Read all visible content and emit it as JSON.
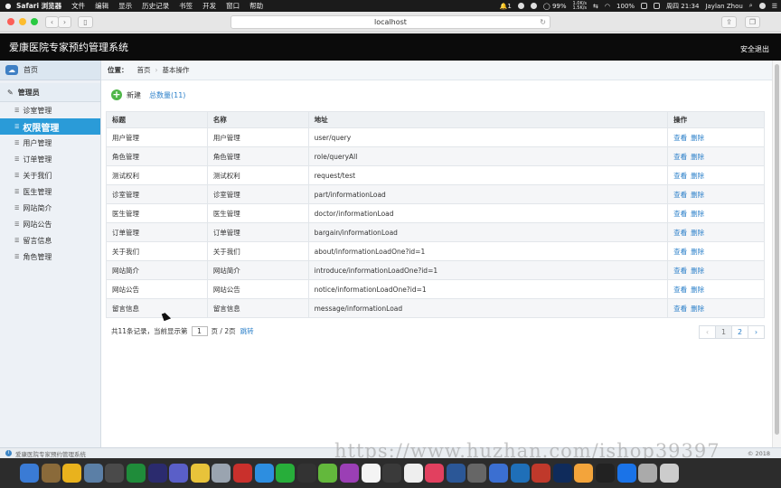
{
  "menubar": {
    "app_name": "Safari 浏览器",
    "items": [
      "文件",
      "编辑",
      "显示",
      "历史记录",
      "书签",
      "开发",
      "窗口",
      "帮助"
    ],
    "notification_count": "1",
    "net_up": "1.0K/s",
    "net_down": "1.5K/s",
    "battery": "99%",
    "wifi_percent": "100%",
    "clock": "周四 21:34",
    "user": "Jaylan Zhou"
  },
  "browser": {
    "url": "localhost"
  },
  "app": {
    "title": "爱康医院专家预约管理系统",
    "logout": "安全退出"
  },
  "sidebar": {
    "home": "首页",
    "section": "管理员",
    "items": [
      {
        "label": "诊室管理",
        "active": false
      },
      {
        "label": "权限管理",
        "active": true
      },
      {
        "label": "用户管理",
        "active": false
      },
      {
        "label": "订单管理",
        "active": false
      },
      {
        "label": "关于我们",
        "active": false
      },
      {
        "label": "医生管理",
        "active": false
      },
      {
        "label": "网站简介",
        "active": false
      },
      {
        "label": "网站公告",
        "active": false
      },
      {
        "label": "留言信息",
        "active": false
      },
      {
        "label": "角色管理",
        "active": false
      }
    ]
  },
  "breadcrumb": {
    "prefix": "位置：",
    "home": "首页",
    "current": "基本操作"
  },
  "toolbar": {
    "new_label": "新建",
    "total_label": "总数量(11)"
  },
  "table": {
    "headers": [
      "标题",
      "名称",
      "地址",
      "操作"
    ],
    "view_label": "查看",
    "delete_label": "删除",
    "rows": [
      [
        "用户管理",
        "用户管理",
        "user/query"
      ],
      [
        "角色管理",
        "角色管理",
        "role/queryAll"
      ],
      [
        "测试权利",
        "测试权利",
        "request/test"
      ],
      [
        "诊室管理",
        "诊室管理",
        "part/informationLoad"
      ],
      [
        "医生管理",
        "医生管理",
        "doctor/informationLoad"
      ],
      [
        "订单管理",
        "订单管理",
        "bargain/informationLoad"
      ],
      [
        "关于我们",
        "关于我们",
        "about/informationLoadOne?id=1"
      ],
      [
        "网站简介",
        "网站简介",
        "introduce/informationLoadOne?id=1"
      ],
      [
        "网站公告",
        "网站公告",
        "notice/informationLoadOne?id=1"
      ],
      [
        "留言信息",
        "留言信息",
        "message/informationLoad"
      ]
    ]
  },
  "pager": {
    "records_text": "共11条记录，",
    "current_prefix": "当前显示第",
    "current_page": "1",
    "page_suffix": "页 / 2页",
    "jump_label": "跳转",
    "prev": "‹",
    "pages": [
      "1",
      "2"
    ],
    "next": "›"
  },
  "statusbar": {
    "text": "爱康医院专家预约管理系统",
    "year": "© 2018"
  },
  "watermark": "https://www.huzhan.com/ishop39397",
  "dock_colors": [
    "#3a7bd5",
    "#8a6a3a",
    "#e9b21d",
    "#5b7fa6",
    "#4a4a4a",
    "#1f8c3a",
    "#2b2b6e",
    "#5a5fc8",
    "#e8c33a",
    "#9aa4b0",
    "#c9302c",
    "#2d8ee0",
    "#27ae3a",
    "#333333",
    "#63b83c",
    "#9b3fb5",
    "#f4f4f4",
    "#3a3a3a",
    "#eeeeee",
    "#e2405f",
    "#2b5797",
    "#666666",
    "#3b6fd1",
    "#1f6fb8",
    "#c0392b",
    "#0f2b5b",
    "#f3a43b",
    "#222222",
    "#1a73e8",
    "#aaaaaa",
    "#cccccc"
  ]
}
